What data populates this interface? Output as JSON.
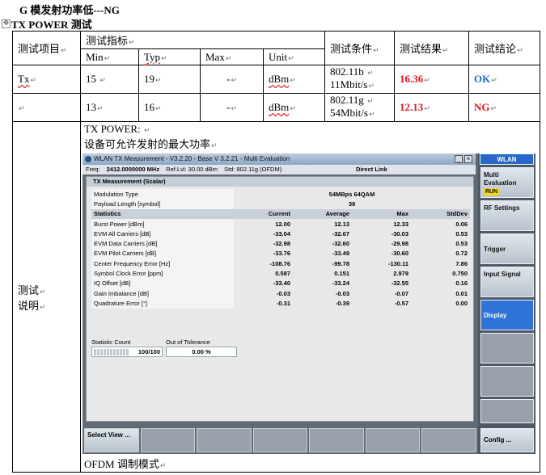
{
  "doc_title": "G 模发射功率低---NG",
  "section_title": "TX POWER 测试",
  "table": {
    "h_item": "测试项目",
    "h_spec": "测试指标",
    "h_cond": "测试条件",
    "h_result": "测试结果",
    "h_conclusion": "测试结论",
    "sub_headers": [
      "Min",
      "Typ",
      "Max",
      "Unit"
    ],
    "rows": [
      {
        "item": "Tx",
        "min": "15",
        "typ": "19",
        "max": "-",
        "unit": "dBm",
        "cond1": "802.11b",
        "cond2": "11Mbit/s",
        "result": "16.36",
        "conclusion": "OK"
      },
      {
        "item": "",
        "min": "13",
        "typ": "16",
        "max": "-",
        "unit": "dBm",
        "cond1": "802.11g",
        "cond2": "54Mbit/s",
        "result": "12.13",
        "conclusion": "NG"
      }
    ],
    "note_label_1": "测试",
    "note_label_2": "说明",
    "note_line1": "TX POWER: ",
    "note_line2": "设备可允许发射的最大功率",
    "note_footer": "OFDM 调制模式"
  },
  "instrument": {
    "window_title": "WLAN TX Measurement - V3.2.20 - Base V 3.2.21 - Multi Evaluation",
    "freq_label": "Freq:",
    "freq_value": "2412.0000000 MHz",
    "ref_lvl": "Ref.Lvl: 30.00 dBm",
    "std": "Std: 802.11g (OFDM)",
    "direct_link": "Direct Link",
    "panel_title": "TX Measurement (Scalar)",
    "modulation_label": "Modulation Type",
    "modulation_value": "54MBps 64QAM",
    "payload_label": "Payload Length [symbol]",
    "payload_value": "39",
    "stats_header": [
      "Statistics",
      "Current",
      "Average",
      "Max",
      "StdDev"
    ],
    "rows": [
      [
        "Burst Power [dBm]",
        "12.00",
        "12.13",
        "12.33",
        "0.06"
      ],
      [
        "EVM All Carriers [dB]",
        "-33.04",
        "-32.67",
        "-30.03",
        "0.53"
      ],
      [
        "EVM Data Carriers [dB]",
        "-32.98",
        "-32.60",
        "-29.98",
        "0.53"
      ],
      [
        "EVM Pilot Carriers [dB]",
        "-33.76",
        "-33.49",
        "-30.60",
        "0.72"
      ],
      [
        "Center Frequency Error [Hz]",
        "-108.76",
        "-99.78",
        "-130.11",
        "7.86"
      ],
      [
        "Symbol Clock Error [ppm]",
        "0.587",
        "0.151",
        "2.979",
        "0.750"
      ],
      [
        "IQ Offset [dB]",
        "-33.40",
        "-33.24",
        "-32.55",
        "0.16"
      ],
      [
        "Gain Imbalance [dB]",
        "-0.03",
        "-0.03",
        "-0.07",
        "0.01"
      ],
      [
        "Quadrature Error [°]",
        "-0.31",
        "-0.39",
        "-0.57",
        "0.00"
      ]
    ],
    "stat_count_label": "Statistic Count",
    "out_tol_label": "Out of Tolerance",
    "stat_count_value": "100/100",
    "stat_count_fraction": 1.0,
    "out_tol_value": "0.00 %",
    "softkey_header": "WLAN",
    "softkeys": [
      "Multi Evaluation",
      "RF Settings",
      "Trigger",
      "Input Signal",
      "Display"
    ],
    "run_badge": "RUN",
    "config_key": "Config ...",
    "select_view": "Select View ...",
    "colors": {
      "result_red": "#e3121c",
      "ok_blue": "#1f6fc0",
      "softkey_active": "#2f73d9",
      "run_yellow": "#f2d624"
    }
  }
}
